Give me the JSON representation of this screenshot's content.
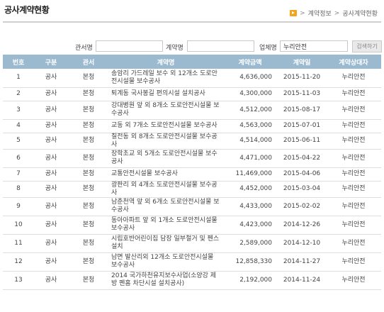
{
  "page": {
    "title": "공사계약현황",
    "breadcrumb": [
      "계약정보",
      "공사계약현황"
    ],
    "separator": ">"
  },
  "search": {
    "office_label": "관서명",
    "office_value": "",
    "contract_label": "계약명",
    "contract_value": "",
    "company_label": "업체명",
    "company_value": "누리안전",
    "button_label": "검색하기"
  },
  "table": {
    "headers": [
      "번호",
      "구분",
      "관서",
      "계약명",
      "계약금액",
      "계약일",
      "계약상대자"
    ],
    "rows": [
      {
        "no": "1",
        "type": "공사",
        "office": "본청",
        "name": "송암리 가드레일 보수 외 12개소 도로안전시설물 보수공사",
        "amount": "4,636,000",
        "date": "2015-11-20",
        "party": "누리안전"
      },
      {
        "no": "2",
        "type": "공사",
        "office": "본청",
        "name": "퇴계동 국사봉길 편의시설 설치공사",
        "amount": "4,300,000",
        "date": "2015-11-03",
        "party": "누리안전"
      },
      {
        "no": "3",
        "type": "공사",
        "office": "본청",
        "name": "강대병원 앞 외 8개소 도로안전시설물 보수공사",
        "amount": "4,512,000",
        "date": "2015-08-17",
        "party": "누리안전"
      },
      {
        "no": "4",
        "type": "공사",
        "office": "본청",
        "name": "교동 외 7개소 도로안전시설물 보수공사",
        "amount": "4,563,000",
        "date": "2015-07-01",
        "party": "누리안전"
      },
      {
        "no": "5",
        "type": "공사",
        "office": "본청",
        "name": "칠전동 외 8개소 도로안전시설물 보수공사",
        "amount": "4,514,000",
        "date": "2015-06-11",
        "party": "누리안전"
      },
      {
        "no": "6",
        "type": "공사",
        "office": "본청",
        "name": "장학초교 외 5개소 도로안전시설물 보수공사",
        "amount": "4,471,000",
        "date": "2015-04-22",
        "party": "누리안전"
      },
      {
        "no": "7",
        "type": "공사",
        "office": "본청",
        "name": "교통안전시설물 보수공사",
        "amount": "11,469,000",
        "date": "2015-04-06",
        "party": "누리안전"
      },
      {
        "no": "8",
        "type": "공사",
        "office": "본청",
        "name": "광판리 외 4개소 도로안전시설물 보수공사",
        "amount": "4,452,000",
        "date": "2015-03-04",
        "party": "누리안전"
      },
      {
        "no": "9",
        "type": "공사",
        "office": "본청",
        "name": "남춘천역 앞 외 6개소 도로안전시설물 보수공사",
        "amount": "4,433,000",
        "date": "2015-02-02",
        "party": "누리안전"
      },
      {
        "no": "10",
        "type": "공사",
        "office": "본청",
        "name": "동아아파트 앞 외 1개소 도로안전시설물 보수공사",
        "amount": "4,423,000",
        "date": "2014-12-26",
        "party": "누리안전"
      },
      {
        "no": "11",
        "type": "공사",
        "office": "본청",
        "name": "시립호반어린이집 담장 일부철거 및 펜스 설치",
        "amount": "2,589,000",
        "date": "2014-12-10",
        "party": "누리안전"
      },
      {
        "no": "12",
        "type": "공사",
        "office": "본청",
        "name": "남면 발산리외 12개소 도로안전시설물 보수공사",
        "amount": "12,858,330",
        "date": "2014-11-27",
        "party": "누리안전"
      },
      {
        "no": "13",
        "type": "공사",
        "office": "본청",
        "name": "2014 국가하천유지보수사업(소양강 제방 펜홈 차단시설 설치공사)",
        "amount": "2,192,000",
        "date": "2014-11-24",
        "party": "누리안전"
      }
    ]
  }
}
